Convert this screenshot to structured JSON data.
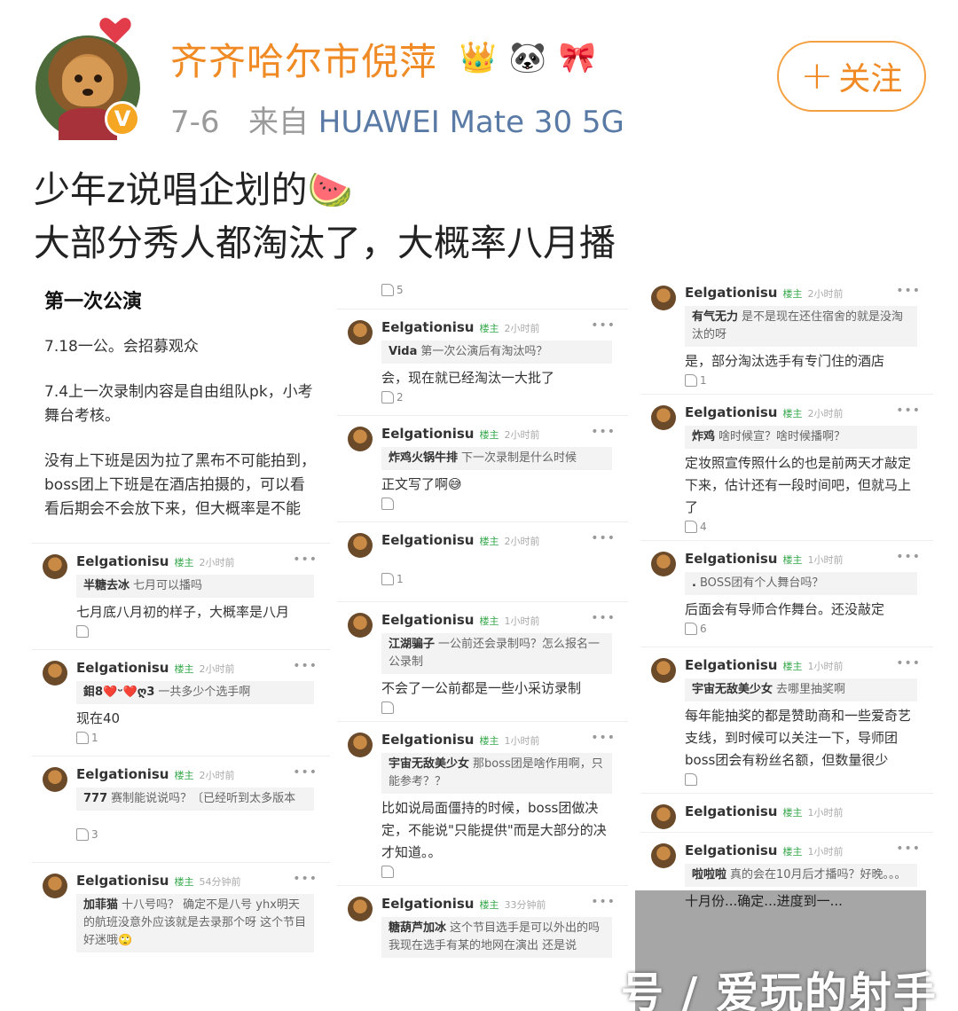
{
  "post": {
    "username": "齐齐哈尔市倪萍",
    "badges": [
      "👑",
      "🐼",
      "🎀"
    ],
    "date": "7-6",
    "source_prefix": "来自",
    "device": "HUAWEI Mate 30 5G",
    "follow_label": "关注",
    "follow_plus": "+",
    "verified": "V",
    "text_line1": "少年z说唱企划的🍉",
    "text_line2": "大部分秀人都淘汰了，大概率八月播"
  },
  "col1": {
    "title": "第一次公演",
    "p1": "7.18一公。会招募观众",
    "p2": "7.4上一次录制内容是自由组队pk，小考舞台考核。",
    "p3": "没有上下班是因为拉了黑布不可能拍到，boss团上下班是在酒店拍摄的，可以看看后期会不会放下来，但大概率是不能",
    "comments": [
      {
        "name": "Eelgationisu",
        "tag": "楼主",
        "time": "2小时前",
        "qname": "半糖去冰",
        "quote": "七月可以播吗",
        "reply": "七月底八月初的样子，大概率是八月",
        "likes": ""
      },
      {
        "name": "Eelgationisu",
        "tag": "楼主",
        "time": "2小时前",
        "qname": "鉬8❤️ᵕ❤️ღ3",
        "quote": "一共多少个选手啊",
        "reply": "现在40",
        "likes": "1"
      },
      {
        "name": "Eelgationisu",
        "tag": "楼主",
        "time": "2小时前",
        "qname": "777",
        "quote": "赛制能说说吗？〔已经听到太多版本",
        "reply": "",
        "likes": "3"
      },
      {
        "name": "Eelgationisu",
        "tag": "楼主",
        "time": "54分钟前",
        "qname": "加菲猫",
        "quote": "十八号吗？ 确定不是八号 yhx明天的航班没意外应该就是去录那个呀 这个节目好迷哦🙄",
        "reply": "",
        "likes": ""
      }
    ]
  },
  "col2": {
    "top_likes": "5",
    "comments": [
      {
        "name": "Eelgationisu",
        "tag": "楼主",
        "time": "2小时前",
        "qname": "Vida",
        "quote": "第一次公演后有淘汰吗？",
        "reply": "会，现在就已经淘汰一大批了",
        "likes": "2"
      },
      {
        "name": "Eelgationisu",
        "tag": "楼主",
        "time": "2小时前",
        "qname": "炸鸡火锅牛排",
        "quote": "下一次录制是什么时候",
        "reply": "正文写了啊😅",
        "likes": ""
      },
      {
        "name": "Eelgationisu",
        "tag": "楼主",
        "time": "2小时前",
        "qname": "",
        "quote": "",
        "reply": "",
        "likes": "1"
      },
      {
        "name": "Eelgationisu",
        "tag": "楼主",
        "time": "1小时前",
        "qname": "江湖骗子",
        "quote": "一公前还会录制吗？怎么报名一公录制",
        "reply": "不会了一公前都是一些小采访录制",
        "likes": ""
      },
      {
        "name": "Eelgationisu",
        "tag": "楼主",
        "time": "1小时前",
        "qname": "宇宙无敌美少女",
        "quote": "那boss团是啥作用啊，只能参考？？",
        "reply": "比如说局面僵持的时候，boss团做决定，不能说\"只能提供\"而是大部分的决才知道。。",
        "likes": ""
      },
      {
        "name": "Eelgationisu",
        "tag": "楼主",
        "time": "33分钟前",
        "qname": "糖葫芦加冰",
        "quote": "这个节目选手是可以外出的吗 我现在选手有某的地网在演出 还是说",
        "reply": "",
        "likes": ""
      }
    ]
  },
  "col3": {
    "comments": [
      {
        "name": "Eelgationisu",
        "tag": "楼主",
        "time": "2小时前",
        "qname": "有气无力",
        "quote": "是不是现在还住宿舍的就是没淘汰的呀",
        "reply": "是，部分淘汰选手有专门住的酒店",
        "likes": "1"
      },
      {
        "name": "Eelgationisu",
        "tag": "楼主",
        "time": "2小时前",
        "qname": "炸鸡",
        "quote": "啥时候宣？啥时候播啊？",
        "reply": "定妆照宣传照什么的也是前两天才敲定下来，估计还有一段时间吧，但就马上了",
        "likes": "4"
      },
      {
        "name": "Eelgationisu",
        "tag": "楼主",
        "time": "1小时前",
        "qname": ".",
        "quote": "BOSS团有个人舞台吗？",
        "reply": "后面会有导师合作舞台。还没敲定",
        "likes": "6"
      },
      {
        "name": "Eelgationisu",
        "tag": "楼主",
        "time": "1小时前",
        "qname": "宇宙无敌美少女",
        "quote": "去哪里抽奖啊",
        "reply": "每年能抽奖的都是赞助商和一些爱奇艺支线，到时候可以关注一下，导师团boss团会有粉丝名额，但数量很少",
        "likes": ""
      },
      {
        "name": "Eelgationisu",
        "tag": "楼主",
        "time": "1小时前",
        "qname": "",
        "quote": "",
        "reply": "",
        "likes": ""
      },
      {
        "name": "Eelgationisu",
        "tag": "楼主",
        "time": "1小时前",
        "qname": "啦啦啦",
        "quote": "真的会在10月后才播吗？好晚。。。",
        "reply": "十月份...确定...进度到一...",
        "likes": ""
      }
    ]
  },
  "watermark": "号 / 爱玩的射手"
}
